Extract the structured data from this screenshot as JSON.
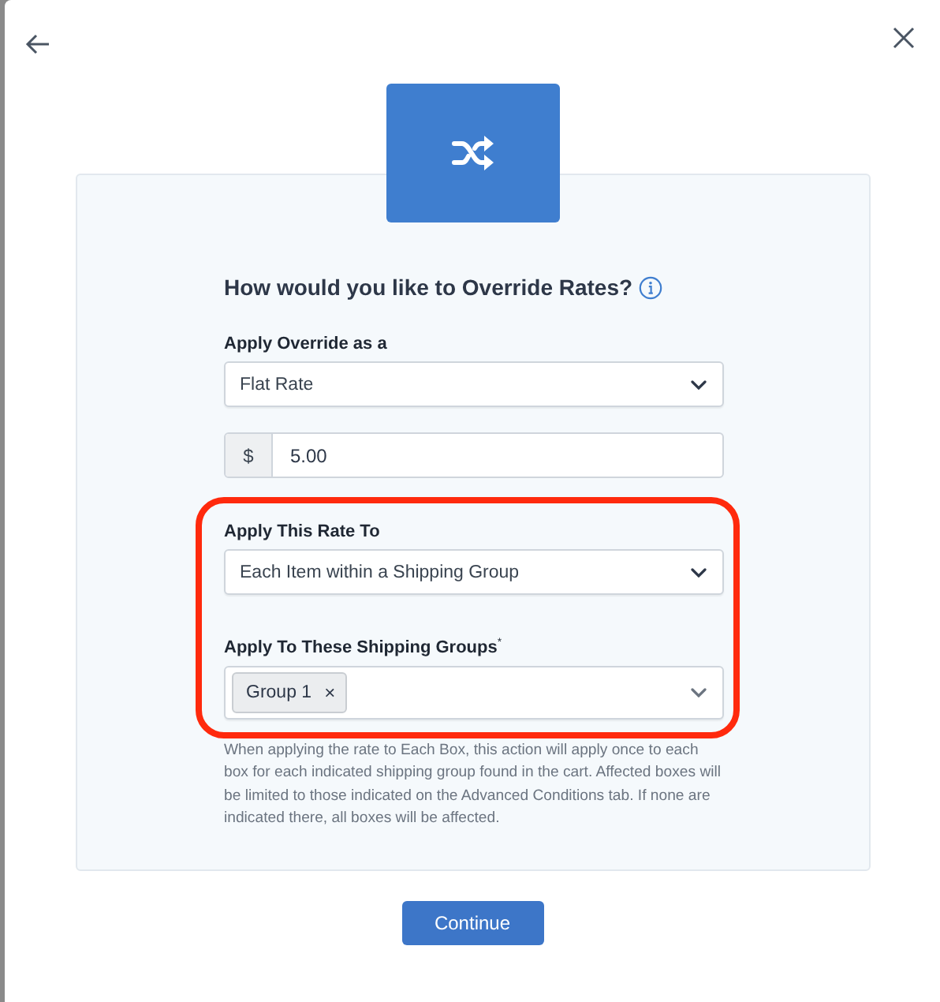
{
  "dialog": {
    "heading": "How would you like to Override Rates?",
    "fields": [
      {
        "kind": "select",
        "label": "Apply Override as a",
        "value": "Flat Rate",
        "highlighted": false
      },
      {
        "kind": "money",
        "prefix": "$",
        "value": "5.00",
        "highlighted": false
      },
      {
        "kind": "select",
        "label": "Apply This Rate To",
        "value": "Each Item within a Shipping Group",
        "highlighted": true
      },
      {
        "kind": "multiselect",
        "label": "Apply To These Shipping Groups",
        "required_mark": "*",
        "tags": [
          "Group 1"
        ],
        "remove_mark": "×",
        "highlighted": true
      }
    ],
    "help_text": "When applying the rate to Each Box, this action will apply once to each box for each indicated shipping group found in the cart. Affected boxes will be limited to those indicated on the Advanced Conditions tab. If none are indicated there, all boxes will be affected.",
    "continue_button": "Continue"
  }
}
